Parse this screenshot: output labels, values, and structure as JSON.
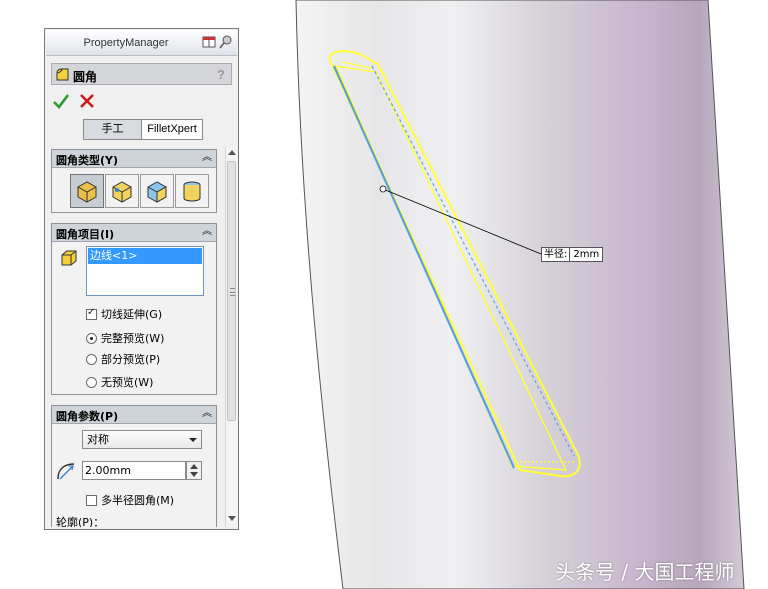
{
  "panel": {
    "title": "PropertyManager",
    "feature_name": "圆角",
    "help": "?",
    "tabs": [
      "手工",
      "FilletXpert"
    ],
    "active_tab": "手工"
  },
  "fillet_type": {
    "title": "圆角类型(Y)",
    "collapse_glyph": "︽",
    "options": [
      "constant-size-fillet-icon",
      "variable-size-fillet-icon",
      "face-fillet-icon",
      "full-round-fillet-icon"
    ],
    "selected_index": 0
  },
  "fillet_items": {
    "title": "圆角项目(I)",
    "collapse_glyph": "︽",
    "list_items": [
      "边线<1>"
    ],
    "tangent_propagation": {
      "label": "切线延伸(G)",
      "checked": true
    },
    "preview": {
      "full": "完整预览(W)",
      "partial": "部分预览(P)",
      "none": "无预览(W)",
      "selected": "full"
    }
  },
  "fillet_params": {
    "title": "圆角参数(P)",
    "collapse_glyph": "︽",
    "method": "对称",
    "radius": "2.00mm",
    "multi_radius": {
      "label": "多半径圆角(M)",
      "checked": false
    },
    "profile_label": "轮廓(P)："
  },
  "callout": {
    "label": "半径:",
    "value": "2mm"
  },
  "watermark": "头条号 / 大国工程师",
  "colors": {
    "highlight_edge": "#ffff33",
    "selected_edge": "#5aa0d8",
    "list_selection": "#3399ff",
    "ok_green": "#2e9a2e",
    "cancel_red": "#cc1a1a",
    "cylinder_mauve": "#c9b8cf"
  }
}
